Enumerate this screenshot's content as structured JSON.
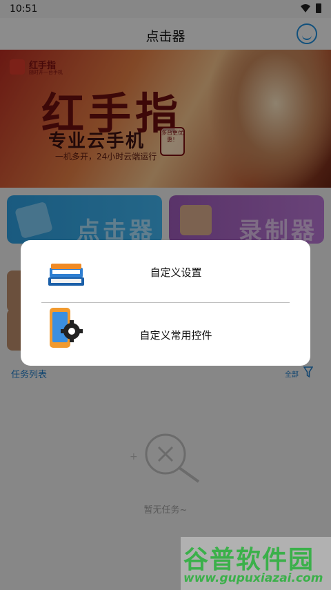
{
  "status_bar": {
    "time": "10:51"
  },
  "header": {
    "title": "点击器"
  },
  "banner": {
    "brand": "红手指",
    "brand_sub": "随时开一台手机",
    "headline": "红手指",
    "subline": "专业云手机",
    "slogan": "一机多开，24小时云端运行",
    "stamp": "多台更优惠！"
  },
  "feature_cards": [
    {
      "label": "点击器",
      "icon": "hand-tap-icon"
    },
    {
      "label": "录制器",
      "icon": "camera-icon"
    }
  ],
  "tasks": {
    "title": "任务列表",
    "filter_label": "全部",
    "empty_text": "暂无任务~"
  },
  "dialog": {
    "options": [
      {
        "label": "自定义设置",
        "icon": "books-icon"
      },
      {
        "label": "自定义常用控件",
        "icon": "phone-gear-icon"
      }
    ]
  },
  "watermark": {
    "line1": "谷普软件园",
    "line2": "www.gupuxiazai.com"
  },
  "colors": {
    "accent": "#1e8bd6",
    "clicker_card": "#2d9cdb",
    "recorder_card": "#9b59b6",
    "watermark": "#3bb04a"
  }
}
